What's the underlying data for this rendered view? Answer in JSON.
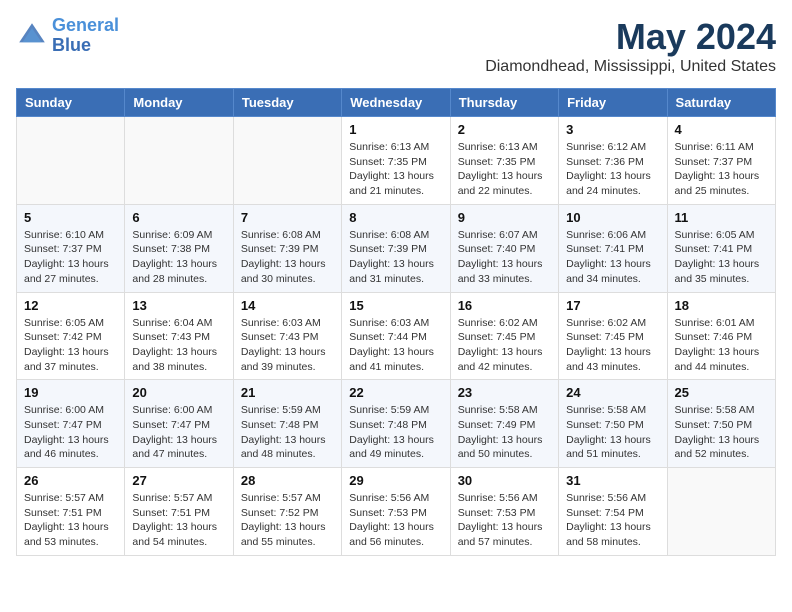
{
  "header": {
    "logo_line1": "General",
    "logo_line2": "Blue",
    "title": "May 2024",
    "subtitle": "Diamondhead, Mississippi, United States"
  },
  "weekdays": [
    "Sunday",
    "Monday",
    "Tuesday",
    "Wednesday",
    "Thursday",
    "Friday",
    "Saturday"
  ],
  "weeks": [
    {
      "days": [
        {
          "num": "",
          "info": ""
        },
        {
          "num": "",
          "info": ""
        },
        {
          "num": "",
          "info": ""
        },
        {
          "num": "1",
          "info": "Sunrise: 6:13 AM\nSunset: 7:35 PM\nDaylight: 13 hours\nand 21 minutes."
        },
        {
          "num": "2",
          "info": "Sunrise: 6:13 AM\nSunset: 7:35 PM\nDaylight: 13 hours\nand 22 minutes."
        },
        {
          "num": "3",
          "info": "Sunrise: 6:12 AM\nSunset: 7:36 PM\nDaylight: 13 hours\nand 24 minutes."
        },
        {
          "num": "4",
          "info": "Sunrise: 6:11 AM\nSunset: 7:37 PM\nDaylight: 13 hours\nand 25 minutes."
        }
      ]
    },
    {
      "days": [
        {
          "num": "5",
          "info": "Sunrise: 6:10 AM\nSunset: 7:37 PM\nDaylight: 13 hours\nand 27 minutes."
        },
        {
          "num": "6",
          "info": "Sunrise: 6:09 AM\nSunset: 7:38 PM\nDaylight: 13 hours\nand 28 minutes."
        },
        {
          "num": "7",
          "info": "Sunrise: 6:08 AM\nSunset: 7:39 PM\nDaylight: 13 hours\nand 30 minutes."
        },
        {
          "num": "8",
          "info": "Sunrise: 6:08 AM\nSunset: 7:39 PM\nDaylight: 13 hours\nand 31 minutes."
        },
        {
          "num": "9",
          "info": "Sunrise: 6:07 AM\nSunset: 7:40 PM\nDaylight: 13 hours\nand 33 minutes."
        },
        {
          "num": "10",
          "info": "Sunrise: 6:06 AM\nSunset: 7:41 PM\nDaylight: 13 hours\nand 34 minutes."
        },
        {
          "num": "11",
          "info": "Sunrise: 6:05 AM\nSunset: 7:41 PM\nDaylight: 13 hours\nand 35 minutes."
        }
      ]
    },
    {
      "days": [
        {
          "num": "12",
          "info": "Sunrise: 6:05 AM\nSunset: 7:42 PM\nDaylight: 13 hours\nand 37 minutes."
        },
        {
          "num": "13",
          "info": "Sunrise: 6:04 AM\nSunset: 7:43 PM\nDaylight: 13 hours\nand 38 minutes."
        },
        {
          "num": "14",
          "info": "Sunrise: 6:03 AM\nSunset: 7:43 PM\nDaylight: 13 hours\nand 39 minutes."
        },
        {
          "num": "15",
          "info": "Sunrise: 6:03 AM\nSunset: 7:44 PM\nDaylight: 13 hours\nand 41 minutes."
        },
        {
          "num": "16",
          "info": "Sunrise: 6:02 AM\nSunset: 7:45 PM\nDaylight: 13 hours\nand 42 minutes."
        },
        {
          "num": "17",
          "info": "Sunrise: 6:02 AM\nSunset: 7:45 PM\nDaylight: 13 hours\nand 43 minutes."
        },
        {
          "num": "18",
          "info": "Sunrise: 6:01 AM\nSunset: 7:46 PM\nDaylight: 13 hours\nand 44 minutes."
        }
      ]
    },
    {
      "days": [
        {
          "num": "19",
          "info": "Sunrise: 6:00 AM\nSunset: 7:47 PM\nDaylight: 13 hours\nand 46 minutes."
        },
        {
          "num": "20",
          "info": "Sunrise: 6:00 AM\nSunset: 7:47 PM\nDaylight: 13 hours\nand 47 minutes."
        },
        {
          "num": "21",
          "info": "Sunrise: 5:59 AM\nSunset: 7:48 PM\nDaylight: 13 hours\nand 48 minutes."
        },
        {
          "num": "22",
          "info": "Sunrise: 5:59 AM\nSunset: 7:48 PM\nDaylight: 13 hours\nand 49 minutes."
        },
        {
          "num": "23",
          "info": "Sunrise: 5:58 AM\nSunset: 7:49 PM\nDaylight: 13 hours\nand 50 minutes."
        },
        {
          "num": "24",
          "info": "Sunrise: 5:58 AM\nSunset: 7:50 PM\nDaylight: 13 hours\nand 51 minutes."
        },
        {
          "num": "25",
          "info": "Sunrise: 5:58 AM\nSunset: 7:50 PM\nDaylight: 13 hours\nand 52 minutes."
        }
      ]
    },
    {
      "days": [
        {
          "num": "26",
          "info": "Sunrise: 5:57 AM\nSunset: 7:51 PM\nDaylight: 13 hours\nand 53 minutes."
        },
        {
          "num": "27",
          "info": "Sunrise: 5:57 AM\nSunset: 7:51 PM\nDaylight: 13 hours\nand 54 minutes."
        },
        {
          "num": "28",
          "info": "Sunrise: 5:57 AM\nSunset: 7:52 PM\nDaylight: 13 hours\nand 55 minutes."
        },
        {
          "num": "29",
          "info": "Sunrise: 5:56 AM\nSunset: 7:53 PM\nDaylight: 13 hours\nand 56 minutes."
        },
        {
          "num": "30",
          "info": "Sunrise: 5:56 AM\nSunset: 7:53 PM\nDaylight: 13 hours\nand 57 minutes."
        },
        {
          "num": "31",
          "info": "Sunrise: 5:56 AM\nSunset: 7:54 PM\nDaylight: 13 hours\nand 58 minutes."
        },
        {
          "num": "",
          "info": ""
        }
      ]
    }
  ]
}
